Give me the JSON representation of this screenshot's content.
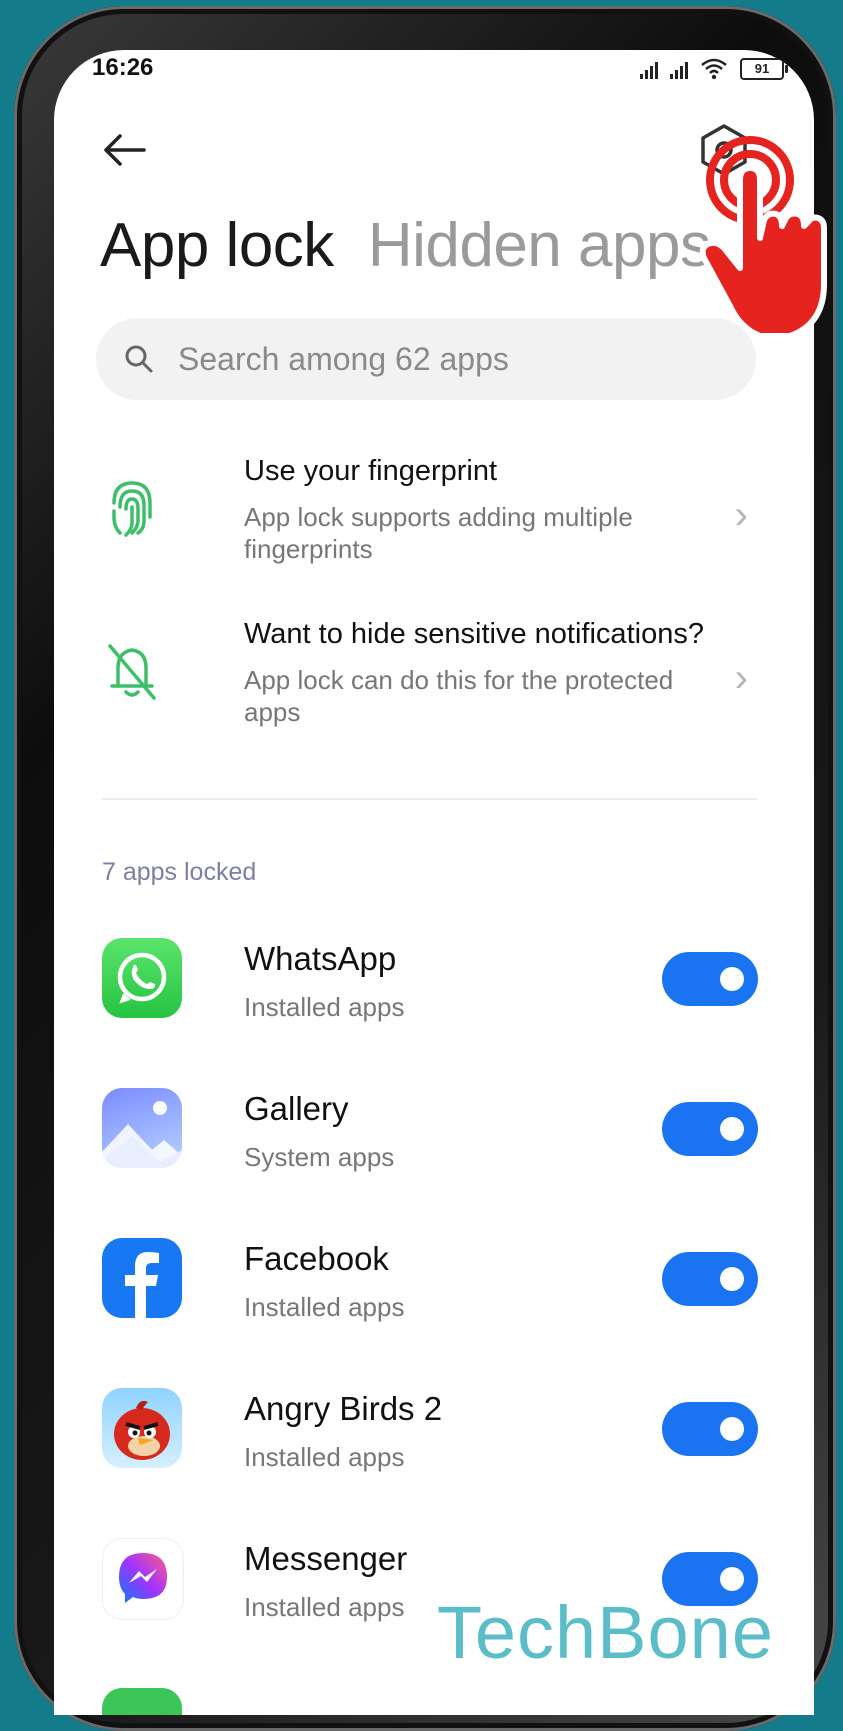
{
  "status_bar": {
    "time": "16:26",
    "battery": "91"
  },
  "header": {
    "back_icon": "back-arrow-icon",
    "settings_icon": "settings-hexagon-icon",
    "tabs": [
      {
        "label": "App lock",
        "active": true
      },
      {
        "label": "Hidden apps",
        "active": false
      }
    ]
  },
  "search": {
    "placeholder": "Search among 62 apps",
    "icon": "search-icon"
  },
  "features": [
    {
      "title": "Use your fingerprint",
      "subtitle": "App lock supports adding multiple fingerprints",
      "icon": "fingerprint-icon"
    },
    {
      "title": "Want to hide sensitive notifications?",
      "subtitle": "App lock can do this for the protected apps",
      "icon": "bell-off-icon"
    }
  ],
  "locked_section": {
    "label": "7 apps locked"
  },
  "apps": [
    {
      "name": "WhatsApp",
      "category": "Installed apps",
      "locked": true
    },
    {
      "name": "Gallery",
      "category": "System apps",
      "locked": true
    },
    {
      "name": "Facebook",
      "category": "Installed apps",
      "locked": true
    },
    {
      "name": "Angry Birds 2",
      "category": "Installed apps",
      "locked": true
    },
    {
      "name": "Messenger",
      "category": "Installed apps",
      "locked": true
    }
  ],
  "colors": {
    "accent": "#1a73f0",
    "feature_green": "#3dbf6a",
    "background": "#147b8a"
  },
  "watermark": "TechBone"
}
